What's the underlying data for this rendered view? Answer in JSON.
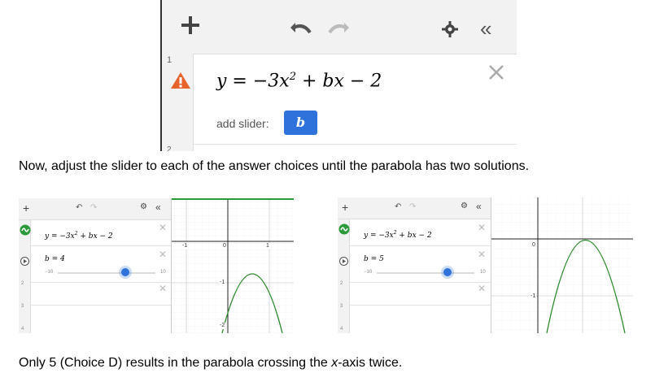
{
  "big_calc": {
    "row1_number": "1",
    "row2_number": "2",
    "expression_lhs": "y = −3x",
    "expression_exp": "2",
    "expression_rhs": "+ bx − 2",
    "add_slider_label": "add slider:",
    "slider_variable": "b"
  },
  "instruction_text": "Now, adjust the slider to each of the answer choices until the parabola has two solutions.",
  "left_calc": {
    "expression_lhs": "y = −3x",
    "expression_exp": "2",
    "expression_rhs": "+ bx − 2",
    "slider_label": "b = 4",
    "slider_min": "−10",
    "slider_max": "10",
    "slider_value": 4,
    "row_numbers": [
      "2",
      "3",
      "4"
    ],
    "axis_x_ticks": [
      "-1",
      "0",
      "1"
    ],
    "axis_y_ticks": [
      "-1",
      "-2"
    ]
  },
  "right_calc": {
    "expression_lhs": "y = −3x",
    "expression_exp": "2",
    "expression_rhs": "+ bx − 2",
    "slider_label": "b = 5",
    "slider_min": "−10",
    "slider_max": "10",
    "slider_value": 5,
    "row_numbers": [
      "2",
      "3",
      "4"
    ],
    "axis_x_ticks": [
      "0"
    ],
    "axis_y_ticks": [
      "-1"
    ]
  },
  "conclusion": {
    "before": "Only 5 (Choice D) results in the parabola crossing the ",
    "italic": "x",
    "after": "-axis twice."
  },
  "colors": {
    "slider_blue": "#2f72dc",
    "curve_green": "#2d8a2d",
    "warning_orange": "#e8632b",
    "desmos_green": "#2a9a3a"
  },
  "icons": [
    "plus-icon",
    "undo-icon",
    "redo-icon",
    "gear-icon",
    "collapse-icon",
    "warning-icon",
    "close-icon",
    "play-icon",
    "desmos-logo-icon"
  ]
}
